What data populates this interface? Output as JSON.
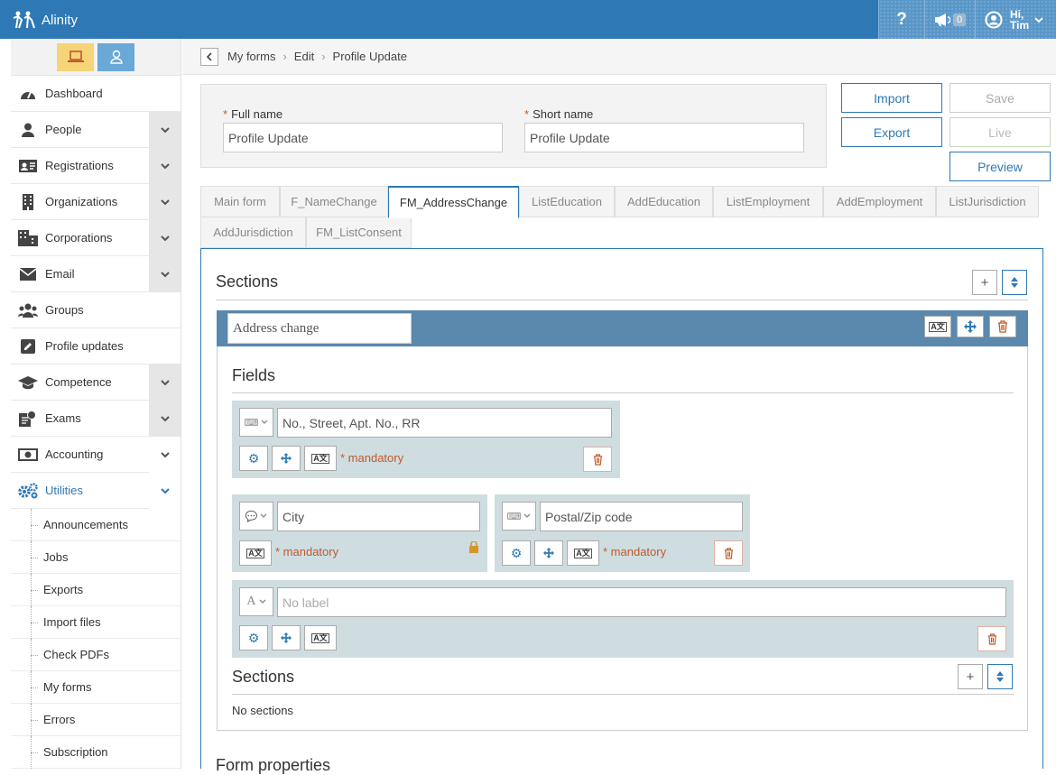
{
  "app": {
    "name": "Alinity"
  },
  "topbar": {
    "help": "?",
    "notifications": "0",
    "user_greeting": "Hi,",
    "user_name": "Tim"
  },
  "sidebar": {
    "items": [
      {
        "label": "Dashboard",
        "icon": "gauge-icon",
        "chevron": false
      },
      {
        "label": "People",
        "icon": "person-icon",
        "chevron": true
      },
      {
        "label": "Registrations",
        "icon": "id-card-icon",
        "chevron": true
      },
      {
        "label": "Organizations",
        "icon": "building-icon",
        "chevron": true
      },
      {
        "label": "Corporations",
        "icon": "buildings-icon",
        "chevron": true
      },
      {
        "label": "Email",
        "icon": "envelope-icon",
        "chevron": true
      },
      {
        "label": "Groups",
        "icon": "users-icon",
        "chevron": false
      },
      {
        "label": "Profile updates",
        "icon": "edit-icon",
        "chevron": false
      },
      {
        "label": "Competence",
        "icon": "graduation-cap-icon",
        "chevron": true
      },
      {
        "label": "Exams",
        "icon": "exam-icon",
        "chevron": true
      },
      {
        "label": "Accounting",
        "icon": "money-icon",
        "chevron": true
      },
      {
        "label": "Utilities",
        "icon": "cogs-icon",
        "chevron": true,
        "active": true
      }
    ],
    "sub_items": [
      "Announcements",
      "Jobs",
      "Exports",
      "Import files",
      "Check PDFs",
      "My forms",
      "Errors",
      "Subscription"
    ]
  },
  "breadcrumb": {
    "items": [
      "My forms",
      "Edit",
      "Profile Update"
    ]
  },
  "form": {
    "full_name_label": "Full name",
    "full_name_value": "Profile Update",
    "short_name_label": "Short name",
    "short_name_value": "Profile Update",
    "required_mark": "*"
  },
  "actions": {
    "import": "Import",
    "save": "Save",
    "export": "Export",
    "live": "Live",
    "preview": "Preview"
  },
  "tabs": [
    "Main form",
    "F_NameChange",
    "FM_AddressChange",
    "ListEducation",
    "AddEducation",
    "ListEmployment",
    "AddEmployment",
    "ListJurisdiction",
    "AddJurisdiction",
    "FM_ListConsent"
  ],
  "active_tab": "FM_AddressChange",
  "editor": {
    "sections_title": "Sections",
    "section_name": "Address change",
    "fields_title": "Fields",
    "fields": [
      {
        "value": "No., Street, Apt. No., RR",
        "mandatory": "* mandatory",
        "type": "keyboard-icon"
      },
      {
        "value": "City",
        "mandatory": "* mandatory",
        "type": "comment-icon"
      },
      {
        "value": "Postal/Zip code",
        "mandatory": "* mandatory",
        "type": "keyboard-icon"
      },
      {
        "value": "No label",
        "mandatory": "",
        "type": "text-icon"
      }
    ],
    "subsections_title": "Sections",
    "no_sections": "No sections",
    "form_properties_title": "Form properties"
  }
}
